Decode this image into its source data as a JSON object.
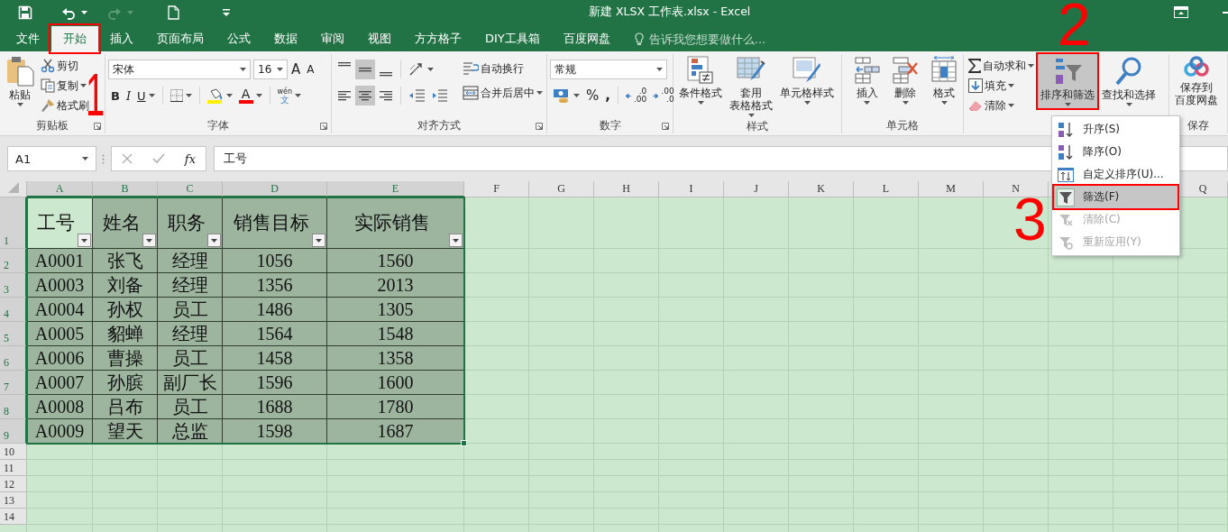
{
  "window": {
    "title": "新建 XLSX 工作表.xlsx - Excel"
  },
  "tabs": [
    {
      "label": "文件",
      "selected": false,
      "highlighted": false
    },
    {
      "label": "开始",
      "selected": true,
      "highlighted": true
    },
    {
      "label": "插入",
      "selected": false,
      "highlighted": false
    },
    {
      "label": "页面布局",
      "selected": false,
      "highlighted": false
    },
    {
      "label": "公式",
      "selected": false,
      "highlighted": false
    },
    {
      "label": "数据",
      "selected": false,
      "highlighted": false
    },
    {
      "label": "审阅",
      "selected": false,
      "highlighted": false
    },
    {
      "label": "视图",
      "selected": false,
      "highlighted": false
    },
    {
      "label": "方方格子",
      "selected": false,
      "highlighted": false
    },
    {
      "label": "DIY工具箱",
      "selected": false,
      "highlighted": false
    },
    {
      "label": "百度网盘",
      "selected": false,
      "highlighted": false
    }
  ],
  "tell_me": {
    "placeholder": "告诉我您想要做什么..."
  },
  "ribbon": {
    "clipboard": {
      "label": "剪贴板",
      "paste": "粘贴",
      "cut": "剪切",
      "copy": "复制",
      "format_painter": "格式刷"
    },
    "font": {
      "label": "字体",
      "font_name": "宋体",
      "font_size": "16",
      "grow": "A",
      "shrink": "A",
      "bold": "B",
      "italic": "I",
      "underline": "U",
      "font_color": "A",
      "phonetic_top": "wén",
      "phonetic_bottom": "文"
    },
    "alignment": {
      "label": "对齐方式",
      "vertical": [
        {
          "selected": false
        },
        {
          "selected": true
        },
        {
          "selected": false
        }
      ],
      "horizontal": [
        {
          "selected": false
        },
        {
          "selected": true
        },
        {
          "selected": false
        }
      ],
      "wrap_text": "自动换行",
      "merge_center": "合并后居中"
    },
    "number": {
      "label": "数字",
      "format": "常规",
      "percent": "%",
      "comma": ",",
      "decimals": [
        {
          "kind": "increase",
          "top": ".0",
          "bottom": ".00"
        },
        {
          "kind": "decrease",
          "top": ".00",
          "bottom": ".0"
        }
      ]
    },
    "styles": {
      "label": "样式",
      "items": [
        {
          "kind": "conditional",
          "lines": [
            "条件格式"
          ]
        },
        {
          "kind": "table",
          "lines": [
            "套用",
            "表格格式"
          ]
        },
        {
          "kind": "cell",
          "lines": [
            "单元格样式"
          ]
        }
      ]
    },
    "cells": {
      "label": "单元格",
      "items": [
        {
          "kind": "insert",
          "label": "插入"
        },
        {
          "kind": "delete",
          "label": "删除"
        },
        {
          "kind": "format",
          "label": "格式"
        }
      ]
    },
    "editing": {
      "autosum": "自动求和",
      "fill": "填充",
      "clear": "清除",
      "sort_filter": {
        "label": "排序和筛选",
        "expanded": true,
        "highlighted": true
      },
      "find": "查找和选择"
    },
    "save": {
      "label": "保存",
      "lines": [
        "保存到",
        "百度网盘"
      ]
    }
  },
  "formula_bar": {
    "name_box": "A1",
    "fx": "fx",
    "value": "工号"
  },
  "sheet": {
    "columns": [
      {
        "label": "A",
        "selected": true
      },
      {
        "label": "B",
        "selected": true
      },
      {
        "label": "C",
        "selected": true
      },
      {
        "label": "D",
        "selected": true
      },
      {
        "label": "E",
        "selected": true
      },
      {
        "label": "F",
        "selected": false
      },
      {
        "label": "G",
        "selected": false
      },
      {
        "label": "H",
        "selected": false
      },
      {
        "label": "I",
        "selected": false
      },
      {
        "label": "J",
        "selected": false
      },
      {
        "label": "K",
        "selected": false
      },
      {
        "label": "L",
        "selected": false
      },
      {
        "label": "M",
        "selected": false
      },
      {
        "label": "N",
        "selected": false
      },
      {
        "label": "Q",
        "selected": false
      }
    ],
    "rows": [
      {
        "label": "1",
        "selected": true
      },
      {
        "label": "2",
        "selected": true
      },
      {
        "label": "3",
        "selected": true
      },
      {
        "label": "4",
        "selected": true
      },
      {
        "label": "5",
        "selected": true
      },
      {
        "label": "6",
        "selected": true
      },
      {
        "label": "7",
        "selected": true
      },
      {
        "label": "8",
        "selected": true
      },
      {
        "label": "9",
        "selected": true
      },
      {
        "label": "10",
        "selected": false
      },
      {
        "label": "11",
        "selected": false
      },
      {
        "label": "12",
        "selected": false
      },
      {
        "label": "13",
        "selected": false
      },
      {
        "label": "14",
        "selected": false
      }
    ],
    "table": {
      "header": [
        {
          "text": "工号",
          "active": true
        },
        {
          "text": "姓名",
          "active": false
        },
        {
          "text": "职务",
          "active": false
        },
        {
          "text": "销售目标",
          "active": false
        },
        {
          "text": "实际销售",
          "active": false
        }
      ],
      "rows": [
        [
          "A0001",
          "张飞",
          "经理",
          "1056",
          "1560"
        ],
        [
          "A0003",
          "刘备",
          "经理",
          "1356",
          "2013"
        ],
        [
          "A0004",
          "孙权",
          "员工",
          "1486",
          "1305"
        ],
        [
          "A0005",
          "貂蝉",
          "经理",
          "1564",
          "1548"
        ],
        [
          "A0006",
          "曹操",
          "员工",
          "1458",
          "1358"
        ],
        [
          "A0007",
          "孙膑",
          "副厂长",
          "1596",
          "1600"
        ],
        [
          "A0008",
          "吕布",
          "员工",
          "1688",
          "1780"
        ],
        [
          "A0009",
          "望天",
          "总监",
          "1598",
          "1687"
        ]
      ]
    }
  },
  "filter_menu": {
    "items": [
      {
        "kind": "sort-asc",
        "label": "升序(S)",
        "disabled": false,
        "checked": false,
        "highlighted": false
      },
      {
        "kind": "sort-desc",
        "label": "降序(O)",
        "disabled": false,
        "checked": false,
        "highlighted": false
      },
      {
        "kind": "custom-sort",
        "label": "自定义排序(U)...",
        "disabled": false,
        "checked": false,
        "highlighted": false
      },
      {
        "kind": "filter",
        "label": "筛选(F)",
        "disabled": false,
        "checked": true,
        "highlighted": true
      },
      {
        "kind": "clear",
        "label": "清除(C)",
        "disabled": true,
        "checked": false,
        "highlighted": false
      },
      {
        "kind": "reapply",
        "label": "重新应用(Y)",
        "disabled": true,
        "checked": false,
        "highlighted": false
      }
    ]
  },
  "annotations": [
    "1",
    "2",
    "3"
  ]
}
